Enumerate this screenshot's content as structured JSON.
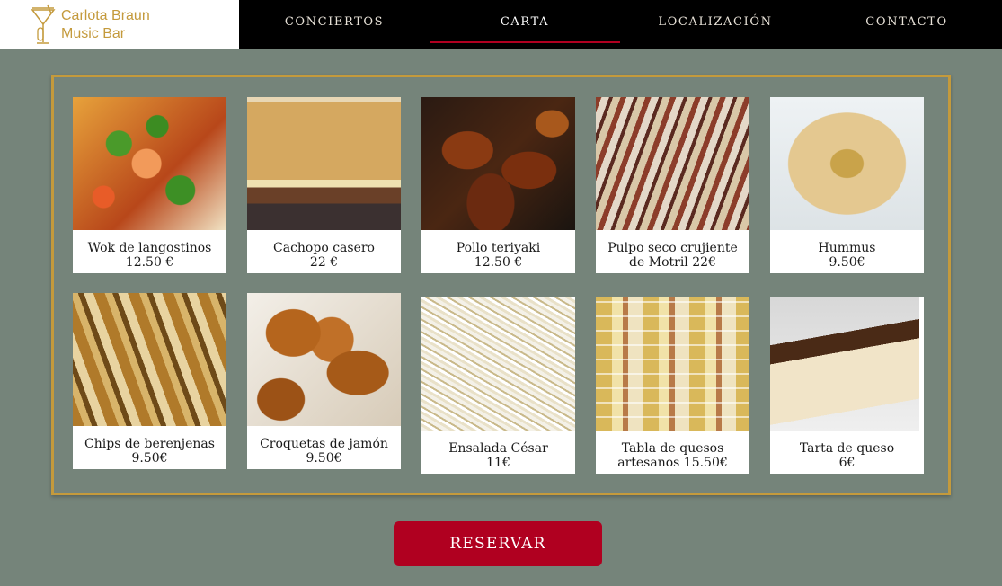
{
  "brand": {
    "line1": "Carlota Braun",
    "line2": "Music Bar",
    "icon": "cocktail-glass-icon",
    "color": "#c49a3c"
  },
  "nav": {
    "items": [
      {
        "label": "CONCIERTOS"
      },
      {
        "label": "CARTA"
      },
      {
        "label": "LOCALIZACIÓN"
      },
      {
        "label": "CONTACTO"
      }
    ],
    "active": "CARTA",
    "active_color": "#b00020"
  },
  "menu": {
    "items": [
      {
        "name": "Wok de langostinos",
        "price": "12.50 €",
        "image": "wok-photo"
      },
      {
        "name": "Cachopo casero",
        "price": "22 €",
        "image": "cachopo-photo"
      },
      {
        "name": "Pollo teriyaki",
        "price": "12.50 €",
        "image": "pollo-photo"
      },
      {
        "name": "Pulpo seco crujiente",
        "price": "de Motril 22€",
        "image": "pulpo-photo"
      },
      {
        "name": "Hummus",
        "price": "9.50€",
        "image": "hummus-photo"
      },
      {
        "name": "Chips de berenjenas",
        "price": "9.50€",
        "image": "chips-photo"
      },
      {
        "name": "Croquetas de jamón",
        "price": "9.50€",
        "image": "croquetas-photo"
      },
      {
        "name": "Ensalada César",
        "price": "11€",
        "image": "cesar-photo"
      },
      {
        "name": "Tabla de quesos",
        "price": "artesanos 15.50€",
        "image": "quesos-photo"
      },
      {
        "name": "Tarta de queso",
        "price": "6€",
        "image": "tarta-photo"
      }
    ],
    "frame_color": "#c49a3c"
  },
  "reserve": {
    "label": "RESERVAR",
    "color": "#b00020"
  }
}
